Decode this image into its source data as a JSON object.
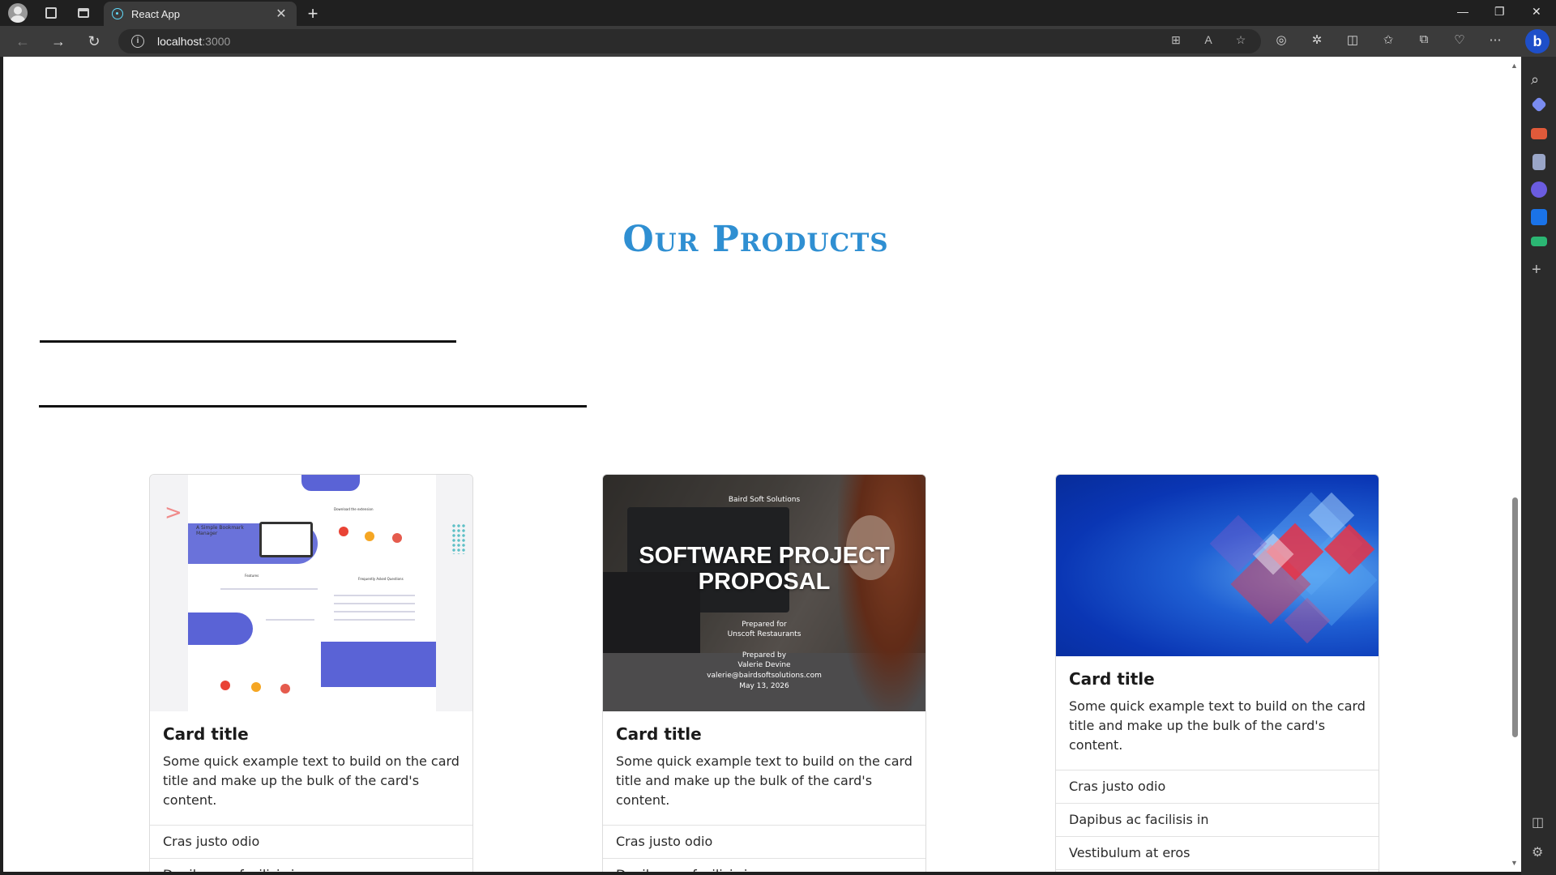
{
  "browser": {
    "tab_title": "React App",
    "url_host": "localhost",
    "url_port": ":3000"
  },
  "page": {
    "section_title": "Our Products",
    "cards": [
      {
        "title": "Card title",
        "text": "Some quick example text to build on the card title and make up the bulk of the card's content.",
        "items": [
          "Cras justo odio",
          "Dapibus ac facilisis in"
        ],
        "image": {
          "kind": "landing-page-mockup",
          "texts": [
            "A Simple Bookmark Manager",
            "Features",
            "Download the extension",
            "Frequently Asked Questions"
          ]
        }
      },
      {
        "title": "Card title",
        "text": "Some quick example text to build on the card title and make up the bulk of the card's content.",
        "items": [
          "Cras justo odio",
          "Dapibus ac facilisis in"
        ],
        "image": {
          "kind": "proposal-photo",
          "company": "Baird Soft Solutions",
          "heading_line1": "SOFTWARE PROJECT",
          "heading_line2": "PROPOSAL",
          "prepared_for": "Prepared for",
          "client": "Unscoft Restaurants",
          "prepared_by": "Prepared by",
          "author": "Valerie Devine",
          "email": "valerie@bairdsoftsolutions.com",
          "date": "May 13, 2026"
        }
      },
      {
        "title": "Card title",
        "text": "Some quick example text to build on the card title and make up the bulk of the card's content.",
        "items": [
          "Cras justo odio",
          "Dapibus ac facilisis in",
          "Vestibulum at eros"
        ],
        "image": {
          "kind": "abstract-diamonds"
        }
      }
    ]
  },
  "colors": {
    "title_blue": "#2f8fd2",
    "browser_dark": "#202020",
    "toolbar": "#3b3b3b",
    "accent_blue": "#1e4fc9"
  }
}
